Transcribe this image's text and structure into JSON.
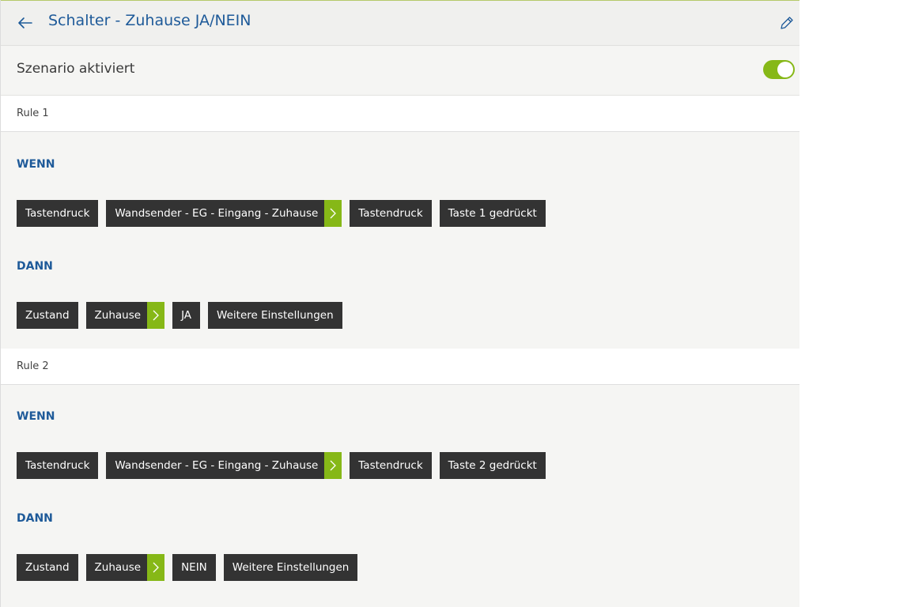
{
  "header": {
    "title": "Schalter - Zuhause JA/NEIN",
    "back_icon": "arrow-left-icon",
    "edit_icon": "pencil-icon"
  },
  "scenario": {
    "label": "Szenario aktiviert",
    "enabled": true,
    "toggle_color": "#86b817"
  },
  "colors": {
    "accent": "#86b817",
    "title": "#1e5a99",
    "chip_bg": "#333333"
  },
  "rules": [
    {
      "title": "Rule 1",
      "when_label": "WENN",
      "when_chips": [
        "Tastendruck",
        "Wandsender - EG - Eingang - Zuhause",
        "Tastendruck",
        "Taste 1 gedrückt"
      ],
      "then_label": "DANN",
      "then_chips": [
        "Zustand",
        "Zuhause",
        "JA",
        "Weitere Einstellungen"
      ]
    },
    {
      "title": "Rule 2",
      "when_label": "WENN",
      "when_chips": [
        "Tastendruck",
        "Wandsender - EG - Eingang - Zuhause",
        "Tastendruck",
        "Taste 2 gedrückt"
      ],
      "then_label": "DANN",
      "then_chips": [
        "Zustand",
        "Zuhause",
        "NEIN",
        "Weitere Einstellungen"
      ]
    }
  ]
}
